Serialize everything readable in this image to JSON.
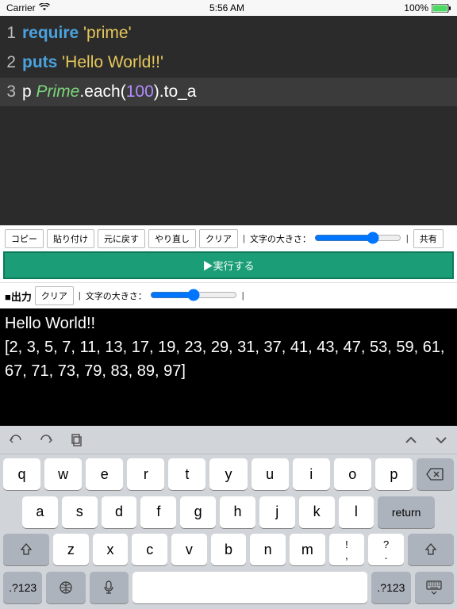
{
  "statusbar": {
    "carrier": "Carrier",
    "time": "5:56 AM",
    "battery": "100%"
  },
  "code": {
    "lines": [
      {
        "n": "1",
        "tokens": [
          [
            "kw",
            "require"
          ],
          [
            "pln",
            " "
          ],
          [
            "str",
            "'prime'"
          ]
        ]
      },
      {
        "n": "2",
        "tokens": [
          [
            "kw",
            "puts"
          ],
          [
            "pln",
            " "
          ],
          [
            "str",
            "'Hello World!!'"
          ]
        ]
      },
      {
        "n": "3",
        "current": true,
        "tokens": [
          [
            "pln",
            "p "
          ],
          [
            "cls",
            "Prime"
          ],
          [
            "pln",
            ".each("
          ],
          [
            "num",
            "100"
          ],
          [
            "pln",
            ").to_a"
          ]
        ]
      }
    ]
  },
  "toolbar": {
    "copy": "コピー",
    "paste": "貼り付け",
    "undo": "元に戻す",
    "redo": "やり直し",
    "clear": "クリア",
    "fontsize_label": "文字の大きさ：",
    "share": "共有",
    "run": "▶実行する"
  },
  "output": {
    "label": "■出力",
    "clear": "クリア",
    "fontsize_label": "文字の大きさ：",
    "lines": [
      "Hello World!!",
      "[2, 3, 5, 7, 11, 13, 17, 19, 23, 29, 31, 37, 41, 43, 47, 53, 59, 61, 67, 71, 73, 79, 83, 89, 97]"
    ]
  },
  "keyboard": {
    "row1": [
      "q",
      "w",
      "e",
      "r",
      "t",
      "y",
      "u",
      "i",
      "o",
      "p"
    ],
    "row2": [
      "a",
      "s",
      "d",
      "f",
      "g",
      "h",
      "j",
      "k",
      "l"
    ],
    "row3": [
      "z",
      "x",
      "c",
      "v",
      "b",
      "n",
      "m"
    ],
    "punct1": {
      "top": "!",
      "bot": ","
    },
    "punct2": {
      "top": "?",
      "bot": "."
    },
    "return": "return",
    "numkey": ".?123"
  }
}
